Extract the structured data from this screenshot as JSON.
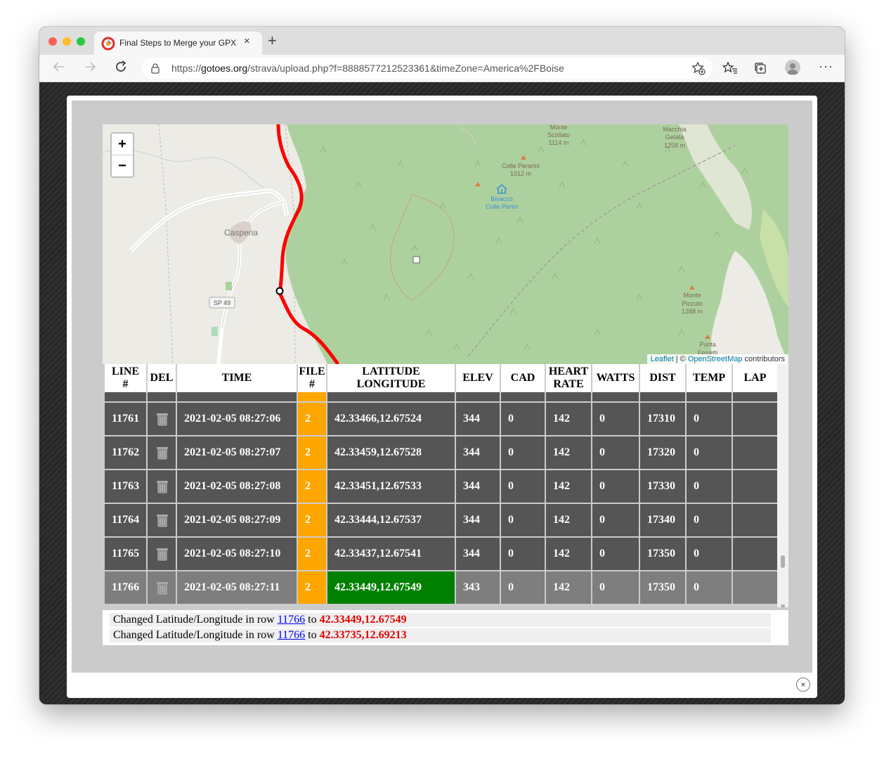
{
  "browser": {
    "tab_title": "Final Steps to Merge your GPX",
    "tab_close": "×",
    "new_tab": "+",
    "url_prefix": "https://",
    "url_host": "gotoes.org",
    "url_path": "/strava/upload.php?f=8888577212523361&timeZone=America%2FBoise",
    "menu": "···"
  },
  "map": {
    "zoom_in": "+",
    "zoom_out": "−",
    "attribution_leaflet": "Leaflet",
    "attribution_sep": " | © ",
    "attribution_osm": "OpenStreetMap",
    "attribution_suffix": " contributors",
    "labels": {
      "casperia": "Casperia",
      "sp49": "SP 49",
      "monte_scollato_1": "Monte",
      "monte_scollato_2": "Scollato",
      "monte_scollato_3": "1114 m",
      "colle_perarini_1": "Colle Perarini",
      "colle_perarini_2": "1012 m",
      "bivacco_1": "Bivacco",
      "bivacco_2": "Colle Perini",
      "macchia_1": "Macchia",
      "macchia_2": "Gelata",
      "macchia_3": "1258 m",
      "pizzuto_1": "Monte",
      "pizzuto_2": "Pizzuto",
      "pizzuto_3": "1288 m",
      "punta_1": "Punta",
      "punta_2": "Ferretti"
    }
  },
  "table": {
    "headers": {
      "line_1": "LINE",
      "line_2": "#",
      "del": "DEL",
      "time": "TIME",
      "file_1": "FILE",
      "file_2": "#",
      "latlon_1": "LATITUDE",
      "latlon_2": "LONGITUDE",
      "elev": "ELEV",
      "cad": "CAD",
      "hr_1": "HEART",
      "hr_2": "RATE",
      "watts": "WATTS",
      "dist": "DIST",
      "temp": "TEMP",
      "lap": "LAP"
    },
    "rows": [
      {
        "line": "11761",
        "time": "2021-02-05 08:27:06",
        "file": "2",
        "latlon": "42.33466,12.67524",
        "elev": "344",
        "cad": "0",
        "hr": "142",
        "watts": "0",
        "dist": "17310",
        "temp": "0",
        "lap": ""
      },
      {
        "line": "11762",
        "time": "2021-02-05 08:27:07",
        "file": "2",
        "latlon": "42.33459,12.67528",
        "elev": "344",
        "cad": "0",
        "hr": "142",
        "watts": "0",
        "dist": "17320",
        "temp": "0",
        "lap": ""
      },
      {
        "line": "11763",
        "time": "2021-02-05 08:27:08",
        "file": "2",
        "latlon": "42.33451,12.67533",
        "elev": "344",
        "cad": "0",
        "hr": "142",
        "watts": "0",
        "dist": "17330",
        "temp": "0",
        "lap": ""
      },
      {
        "line": "11764",
        "time": "2021-02-05 08:27:09",
        "file": "2",
        "latlon": "42.33444,12.67537",
        "elev": "344",
        "cad": "0",
        "hr": "142",
        "watts": "0",
        "dist": "17340",
        "temp": "0",
        "lap": ""
      },
      {
        "line": "11765",
        "time": "2021-02-05 08:27:10",
        "file": "2",
        "latlon": "42.33437,12.67541",
        "elev": "344",
        "cad": "0",
        "hr": "142",
        "watts": "0",
        "dist": "17350",
        "temp": "0",
        "lap": ""
      },
      {
        "line": "11766",
        "time": "2021-02-05 08:27:11",
        "file": "2",
        "latlon": "42.33449,12.67549",
        "elev": "343",
        "cad": "0",
        "hr": "142",
        "watts": "0",
        "dist": "17350",
        "temp": "0",
        "lap": ""
      }
    ]
  },
  "log": [
    {
      "prefix": "Changed Latitude/Longitude in row ",
      "row": "11766",
      "mid": " to ",
      "value": "42.33449,12.67549"
    },
    {
      "prefix": "Changed Latitude/Longitude in row ",
      "row": "11766",
      "mid": " to ",
      "value": "42.33735,12.69213"
    }
  ],
  "modal_close": "×",
  "colors": {
    "row_bg": "#555555",
    "row_selected_bg": "#7e7e7e",
    "file_cell": "#ffa500",
    "changed_cell": "#008000",
    "route": "#ff0000",
    "log_value": "#e00000",
    "forest": "#add19e"
  }
}
